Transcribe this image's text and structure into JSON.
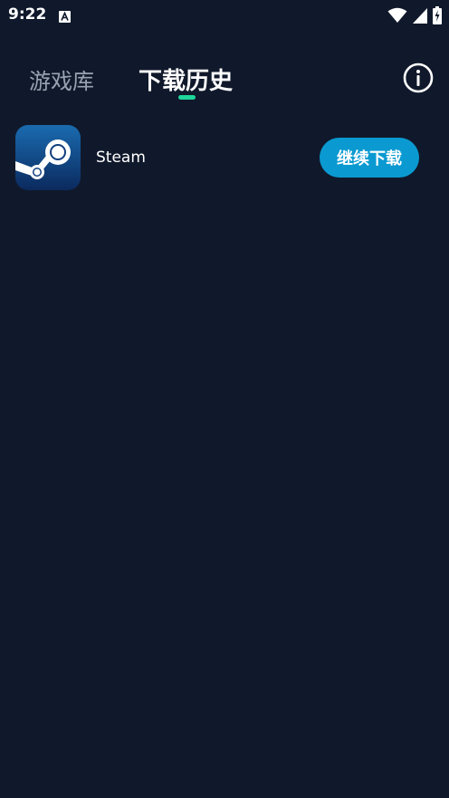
{
  "status_bar": {
    "time": "9:22",
    "icons": [
      "notification-a-icon",
      "wifi-icon",
      "signal-icon",
      "battery-charging-icon"
    ]
  },
  "tabs": [
    {
      "label": "游戏库",
      "active": false
    },
    {
      "label": "下载历史",
      "active": true
    }
  ],
  "header": {
    "info_icon": "info-icon"
  },
  "downloads": [
    {
      "name": "Steam",
      "icon": "steam-logo-icon",
      "action_label": "继续下载"
    }
  ],
  "colors": {
    "background": "#10192b",
    "indicator": "#1fd69a",
    "button": "#0a9ad1",
    "inactive_tab": "#9aa2b1"
  }
}
